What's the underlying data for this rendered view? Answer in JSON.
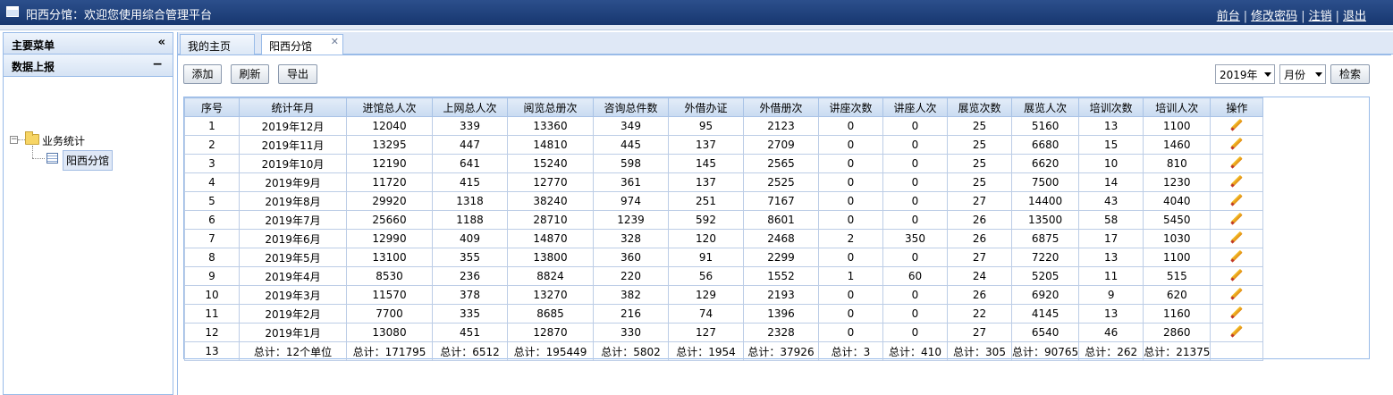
{
  "header": {
    "title": "阳西分馆：欢迎您使用综合管理平台",
    "links": [
      "前台",
      "修改密码",
      "注销",
      "退出"
    ]
  },
  "sidebar": {
    "title": "主要菜单",
    "collapse_glyph": "«",
    "section": "数据上报",
    "section_toggle": "−",
    "tree": {
      "folder": "业务统计",
      "leaf": "阳西分馆"
    }
  },
  "tabs": [
    {
      "label": "我的主页"
    },
    {
      "label": "阳西分馆"
    }
  ],
  "toolbar": {
    "add": "添加",
    "refresh": "刷新",
    "export": "导出",
    "year": "2019年",
    "month": "月份",
    "search": "检索"
  },
  "table": {
    "columns": [
      "序号",
      "统计年月",
      "进馆总人次",
      "上网总人次",
      "阅览总册次",
      "咨询总件数",
      "外借办证",
      "外借册次",
      "讲座次数",
      "讲座人次",
      "展览次数",
      "展览人次",
      "培训次数",
      "培训人次",
      "操作"
    ],
    "rows": [
      [
        "1",
        "2019年12月",
        "12040",
        "339",
        "13360",
        "349",
        "95",
        "2123",
        "0",
        "0",
        "25",
        "5160",
        "13",
        "1100"
      ],
      [
        "2",
        "2019年11月",
        "13295",
        "447",
        "14810",
        "445",
        "137",
        "2709",
        "0",
        "0",
        "25",
        "6680",
        "15",
        "1460"
      ],
      [
        "3",
        "2019年10月",
        "12190",
        "641",
        "15240",
        "598",
        "145",
        "2565",
        "0",
        "0",
        "25",
        "6620",
        "10",
        "810"
      ],
      [
        "4",
        "2019年9月",
        "11720",
        "415",
        "12770",
        "361",
        "137",
        "2525",
        "0",
        "0",
        "25",
        "7500",
        "14",
        "1230"
      ],
      [
        "5",
        "2019年8月",
        "29920",
        "1318",
        "38240",
        "974",
        "251",
        "7167",
        "0",
        "0",
        "27",
        "14400",
        "43",
        "4040"
      ],
      [
        "6",
        "2019年7月",
        "25660",
        "1188",
        "28710",
        "1239",
        "592",
        "8601",
        "0",
        "0",
        "26",
        "13500",
        "58",
        "5450"
      ],
      [
        "7",
        "2019年6月",
        "12990",
        "409",
        "14870",
        "328",
        "120",
        "2468",
        "2",
        "350",
        "26",
        "6875",
        "17",
        "1030"
      ],
      [
        "8",
        "2019年5月",
        "13100",
        "355",
        "13800",
        "360",
        "91",
        "2299",
        "0",
        "0",
        "27",
        "7220",
        "13",
        "1100"
      ],
      [
        "9",
        "2019年4月",
        "8530",
        "236",
        "8824",
        "220",
        "56",
        "1552",
        "1",
        "60",
        "24",
        "5205",
        "11",
        "515"
      ],
      [
        "10",
        "2019年3月",
        "11570",
        "378",
        "13270",
        "382",
        "129",
        "2193",
        "0",
        "0",
        "26",
        "6920",
        "9",
        "620"
      ],
      [
        "11",
        "2019年2月",
        "7700",
        "335",
        "8685",
        "216",
        "74",
        "1396",
        "0",
        "0",
        "22",
        "4145",
        "13",
        "1160"
      ],
      [
        "12",
        "2019年1月",
        "13080",
        "451",
        "12870",
        "330",
        "127",
        "2328",
        "0",
        "0",
        "27",
        "6540",
        "46",
        "2860"
      ]
    ],
    "total": [
      "13",
      "总计：12个单位",
      "总计：171795",
      "总计：6512",
      "总计：195449",
      "总计：5802",
      "总计：1954",
      "总计：37926",
      "总计：3",
      "总计：410",
      "总计：305",
      "总计：90765",
      "总计：262",
      "总计：21375",
      ""
    ],
    "edit_icon": "pencil-icon"
  }
}
